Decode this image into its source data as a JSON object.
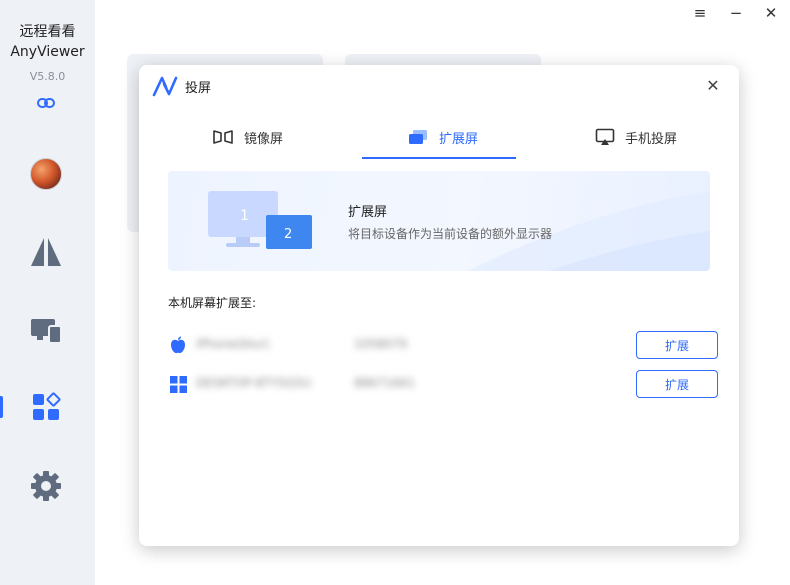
{
  "app": {
    "name_cn": "远程看看",
    "name_en": "AnyViewer",
    "version": "V5.8.0"
  },
  "colors": {
    "accent": "#2f6bff",
    "sidebar_bg": "#eef1f6",
    "icon_gray": "#5f6b7e"
  },
  "sidebar": {
    "items": [
      {
        "name": "avatar"
      },
      {
        "name": "connect-icon"
      },
      {
        "name": "devices-icon"
      },
      {
        "name": "tools-icon"
      },
      {
        "name": "settings-icon"
      }
    ],
    "active_index": 3
  },
  "window_controls": {
    "menu": "≡",
    "minimize": "−",
    "close": "✕"
  },
  "dialog": {
    "title": "投屏",
    "close": "✕",
    "tabs": [
      {
        "label": "镜像屏",
        "icon": "mirror-screen-icon",
        "active": false
      },
      {
        "label": "扩展屏",
        "icon": "extend-screen-icon",
        "active": true
      },
      {
        "label": "手机投屏",
        "icon": "phone-cast-icon",
        "active": false
      }
    ],
    "banner": {
      "title": "扩展屏",
      "description": "将目标设备作为当前设备的额外显示器",
      "screen1": "1",
      "screen2": "2"
    },
    "section_label": "本机屏幕扩展至:",
    "devices": [
      {
        "os": "apple-icon",
        "name": "iPhone(blur)",
        "id": "1058070",
        "button": "扩展"
      },
      {
        "os": "windows-icon",
        "name": "DESKTOP-8TY5G5U",
        "id": "88671661",
        "button": "扩展"
      }
    ]
  }
}
